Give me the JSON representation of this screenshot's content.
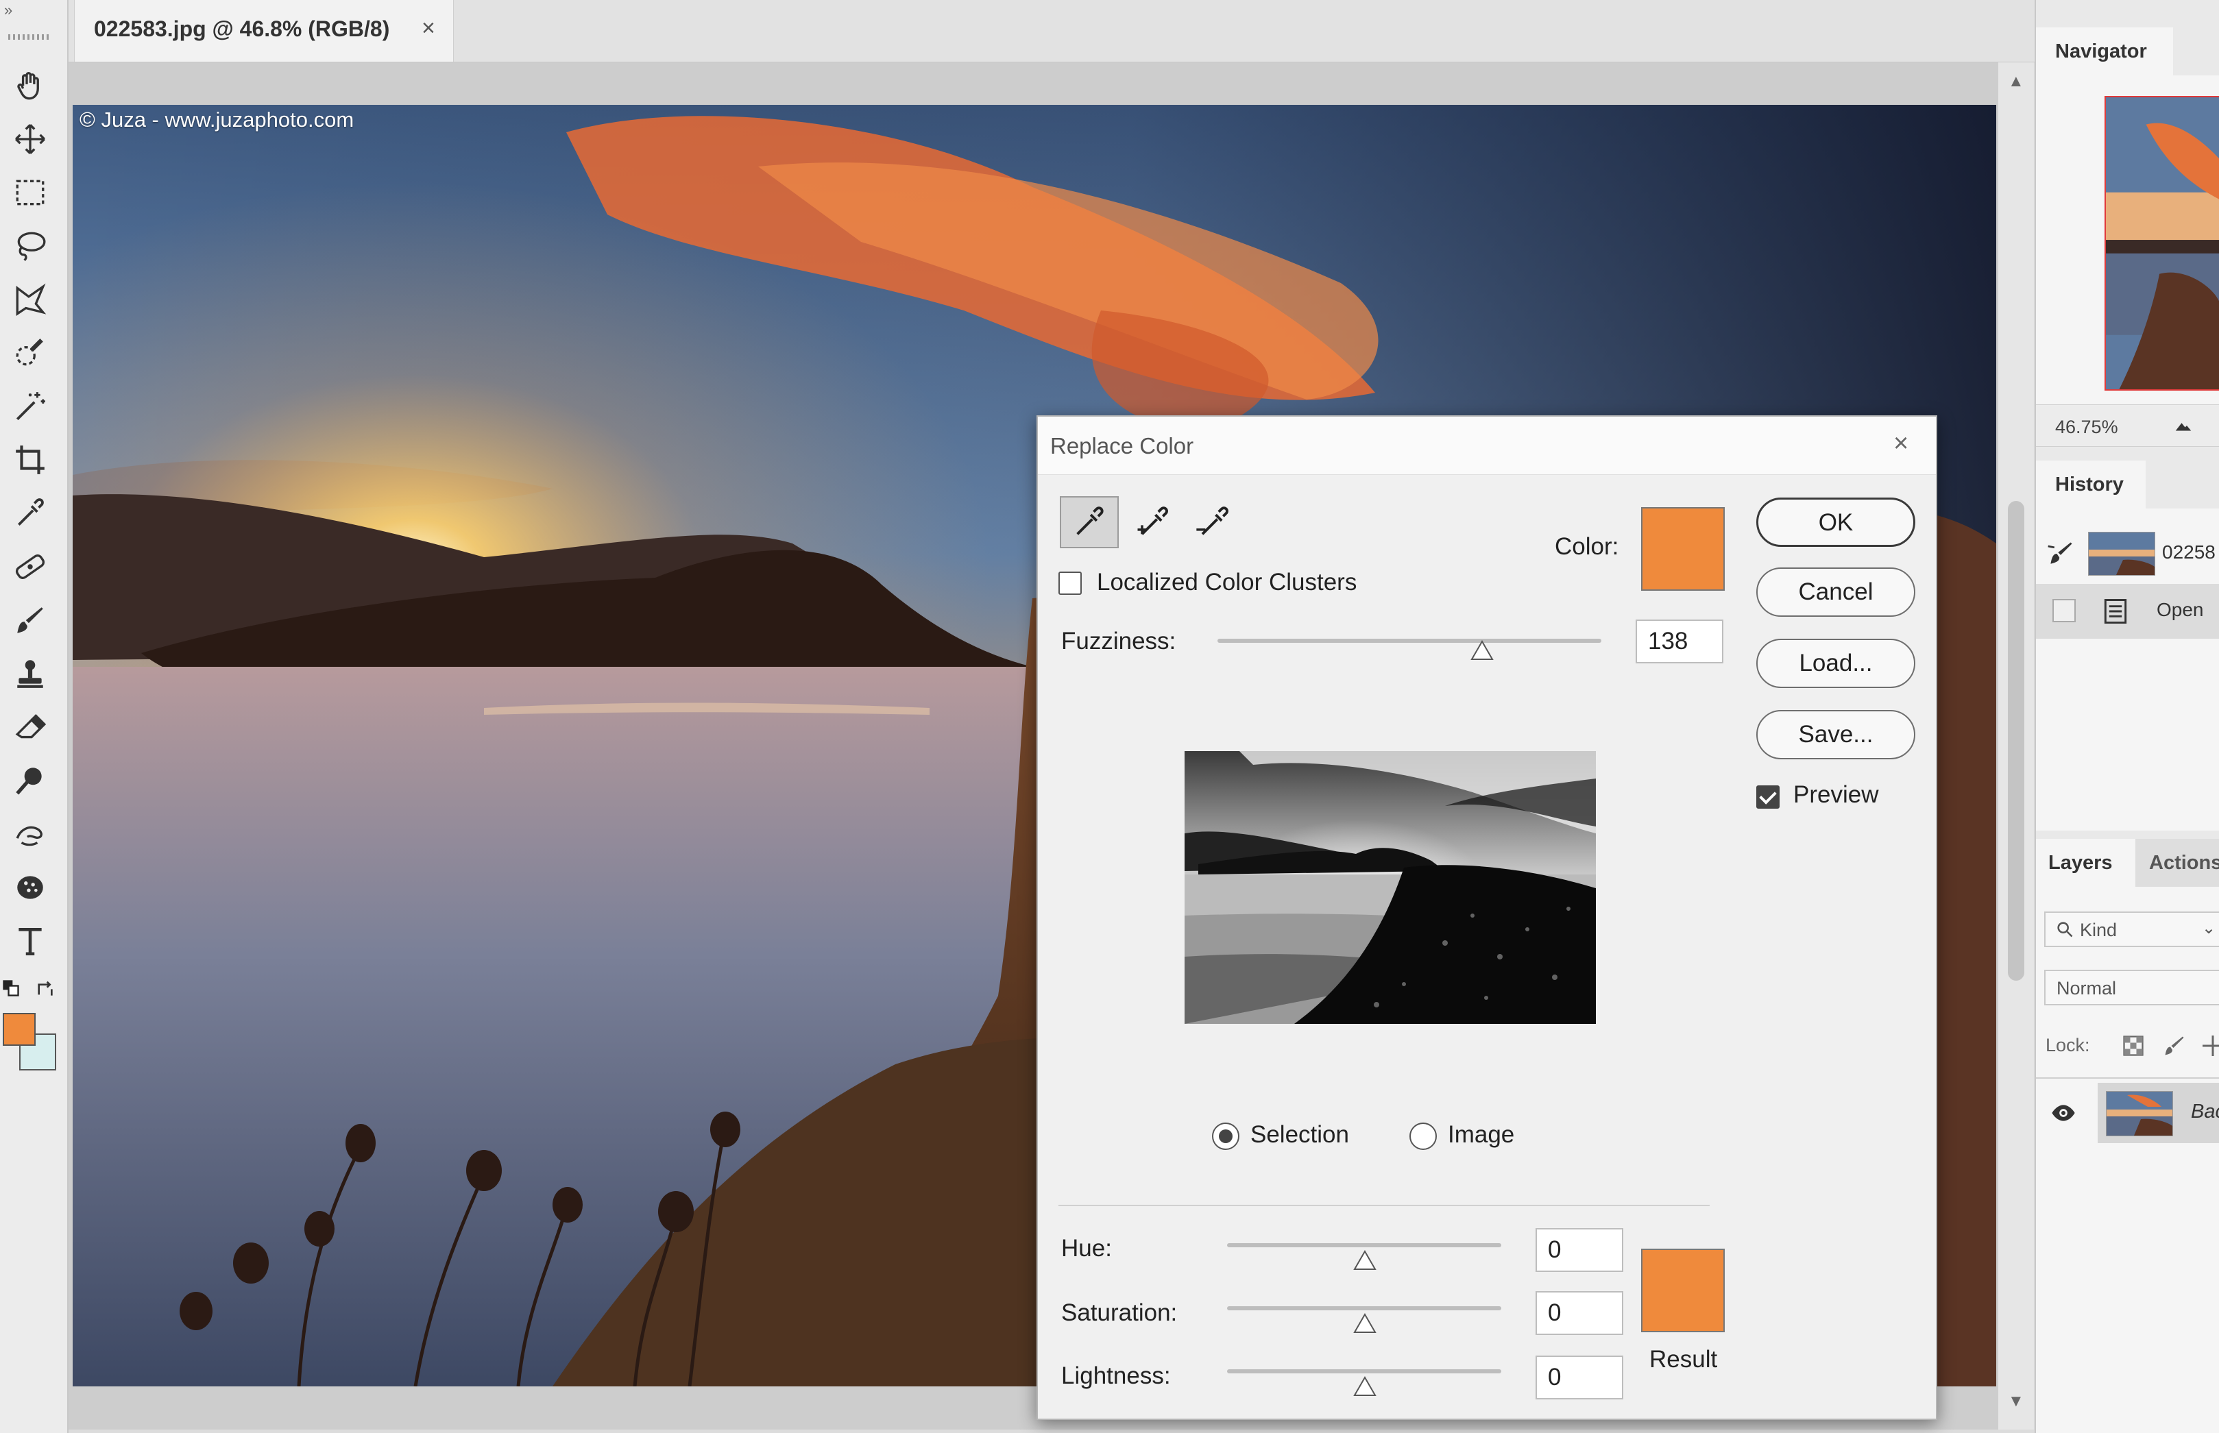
{
  "document": {
    "tab_title": "022583.jpg @ 46.8% (RGB/8)",
    "tab_close": "×",
    "watermark": "© Juza - www.juzaphoto.com"
  },
  "toolbox": {
    "collapse_glyph": "»",
    "tools": [
      "hand-tool-icon",
      "move-tool-icon",
      "marquee-tool-icon",
      "lasso-tool-icon",
      "polygonal-lasso-tool-icon",
      "quick-selection-tool-icon",
      "magic-wand-tool-icon",
      "crop-tool-icon",
      "eyedropper-tool-icon",
      "healing-brush-tool-icon",
      "brush-tool-icon",
      "clone-stamp-tool-icon",
      "eraser-tool-icon",
      "dodge-tool-icon",
      "smudge-tool-icon",
      "sponge-tool-icon",
      "type-tool-icon"
    ],
    "foreground_color": "#ef8a3c",
    "background_color": "#d7eeee"
  },
  "navigator": {
    "tab_label": "Navigator",
    "zoom_value": "46.75%"
  },
  "history": {
    "tab_label": "History",
    "snapshot_label": "02258",
    "items": [
      {
        "label": "Open"
      }
    ]
  },
  "layers": {
    "tabs": [
      {
        "label": "Layers"
      },
      {
        "label": "Actions"
      }
    ],
    "filter_placeholder": "Kind",
    "blend_mode": "Normal",
    "lock_label": "Lock:",
    "layer_name": "Bac"
  },
  "dialog": {
    "title": "Replace Color",
    "close": "×",
    "color_label": "Color:",
    "color_value": "#ef8a3c",
    "localized_label": "Localized Color Clusters",
    "localized_checked": false,
    "fuzziness_label": "Fuzziness:",
    "fuzziness_value": "138",
    "fuzziness_fraction": 0.69,
    "view_options": [
      {
        "label": "Selection",
        "selected": true
      },
      {
        "label": "Image",
        "selected": false
      }
    ],
    "hue_label": "Hue:",
    "hue_value": "0",
    "saturation_label": "Saturation:",
    "saturation_value": "0",
    "lightness_label": "Lightness:",
    "lightness_value": "0",
    "result_label": "Result",
    "result_color": "#ef8a3c",
    "buttons": {
      "ok": "OK",
      "cancel": "Cancel",
      "load": "Load...",
      "save": "Save..."
    },
    "preview_label": "Preview",
    "preview_checked": true
  }
}
